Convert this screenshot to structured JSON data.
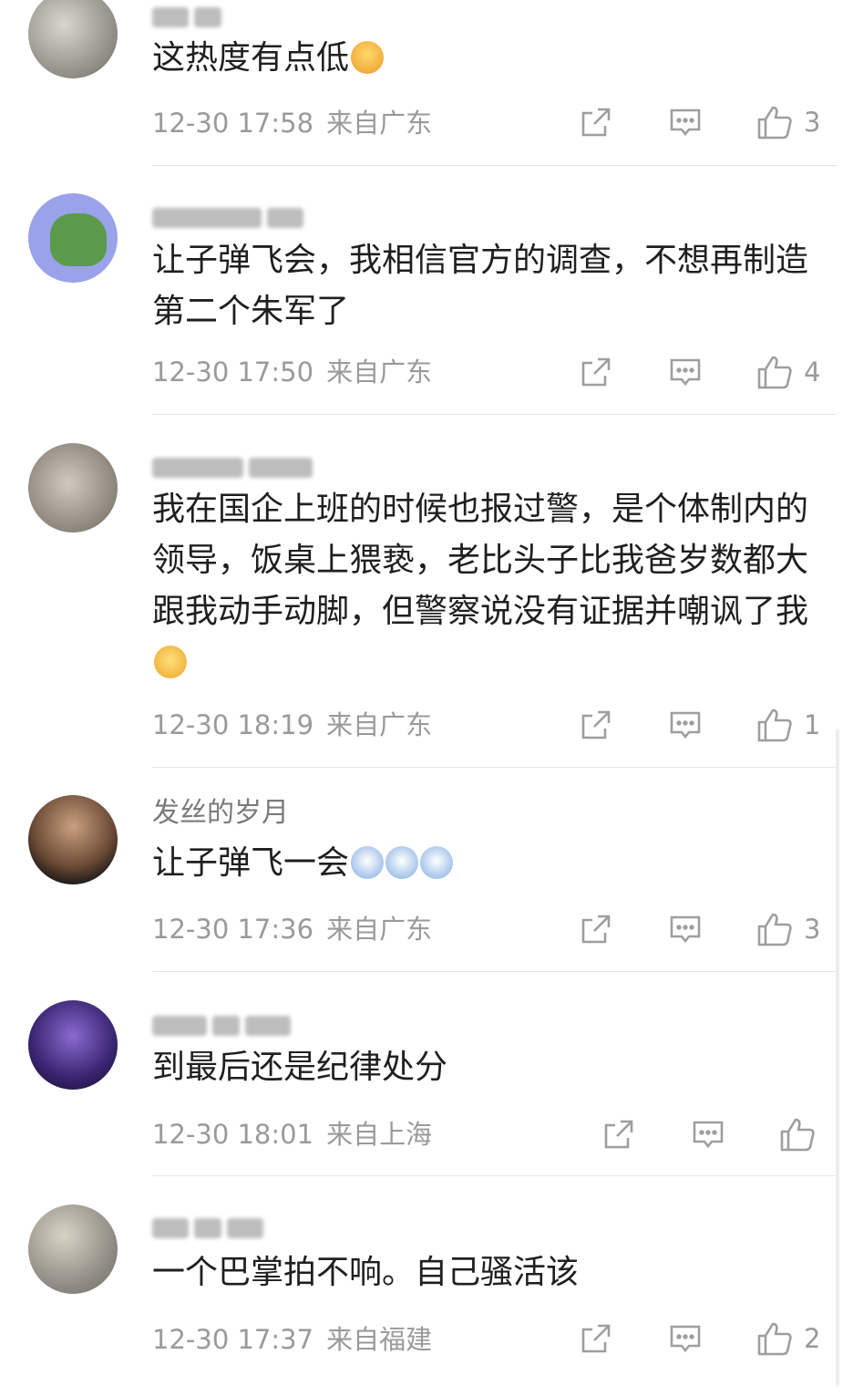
{
  "comments": [
    {
      "username": "",
      "text": "这热度有点低",
      "time": "12-30 17:58",
      "location": "来自广东",
      "likes": "3"
    },
    {
      "username": "",
      "text": "让子弹飞会，我相信官方的调查，不想再制造第二个朱军了",
      "time": "12-30 17:50",
      "location": "来自广东",
      "likes": "4"
    },
    {
      "username": "",
      "text": "我在国企上班的时候也报过警，是个体制内的领导，饭桌上猥亵，老比头子比我爸岁数都大跟我动手动脚，但警察说没有证据并嘲讽了我",
      "time": "12-30 18:19",
      "location": "来自广东",
      "likes": "1"
    },
    {
      "username": "发丝的岁月",
      "text": "让子弹飞一会",
      "time": "12-30 17:36",
      "location": "来自广东",
      "likes": "3"
    },
    {
      "username": "",
      "text": "到最后还是纪律处分",
      "time": "12-30 18:01",
      "location": "来自上海",
      "likes": ""
    },
    {
      "username": "",
      "text": "一个巴掌拍不响。自己骚活该",
      "time": "12-30 17:37",
      "location": "来自福建",
      "likes": "2"
    }
  ],
  "icons": {
    "repost": "share-box-icon",
    "reply": "comment-bubble-icon",
    "like": "thumbs-up-icon"
  },
  "colors": {
    "text": "#1f1f1f",
    "meta": "#9a9a9a",
    "icon": "#9e9e9e",
    "divider": "#e6e6e6"
  }
}
